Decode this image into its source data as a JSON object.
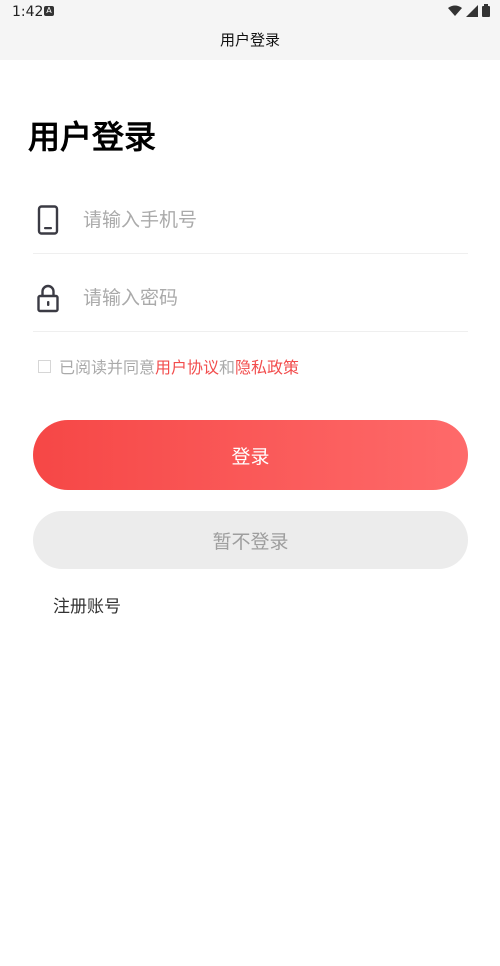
{
  "status_bar": {
    "time": "1:42",
    "notification_icon": "A"
  },
  "app_bar": {
    "title": "用户登录"
  },
  "page": {
    "heading": "用户登录"
  },
  "phone_field": {
    "placeholder": "请输入手机号",
    "value": ""
  },
  "password_field": {
    "placeholder": "请输入密码",
    "value": ""
  },
  "agreement": {
    "prefix": "已阅读并同意",
    "user_agreement": "用户协议",
    "and": "和",
    "privacy_policy": "隐私政策"
  },
  "buttons": {
    "login": "登录",
    "skip": "暂不登录",
    "register": "注册账号"
  },
  "colors": {
    "accent": "#f24d4d",
    "gradient_start": "#f64746",
    "gradient_end": "#fe6a6a",
    "disabled_bg": "#ececec"
  }
}
